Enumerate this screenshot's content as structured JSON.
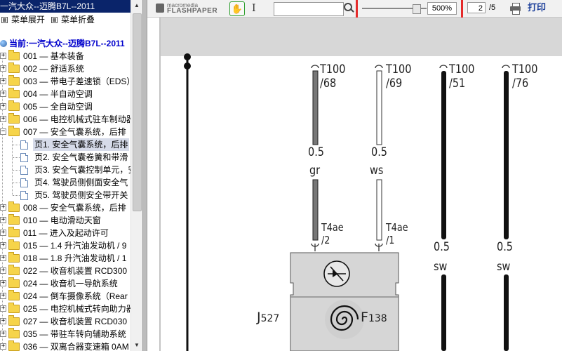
{
  "window": {
    "title": "一汽大众--迈腾B7L--2011"
  },
  "menu": {
    "expand_label": "菜单展开",
    "collapse_label": "菜单折叠"
  },
  "tree": {
    "current": "当前:一汽大众--迈腾B7L--2011",
    "items_a": [
      "001 — 基本装备",
      "002 — 舒适系统",
      "003 — 带电子差速锁（EDS）",
      "004 — 半自动空调",
      "005 — 全自动空调",
      "006 — 电控机械式驻车制动器",
      "007 — 安全气囊系统，后排"
    ],
    "pages": [
      "页1. 安全气囊系统，后排",
      "页2. 安全气囊卷簧和带滑",
      "页3. 安全气囊控制单元，安",
      "页4. 驾驶员侧侧面安全气",
      "页5. 驾驶员侧安全带开关"
    ],
    "items_b": [
      "008 — 安全气囊系统，后排",
      "010 — 电动滑动天窗",
      "011 — 进入及起动许可",
      "015 — 1.4 升汽油发动机 / 9",
      "018 — 1.8 升汽油发动机 / 1",
      "022 — 收音机装置 RCD300",
      "024 — 收音机一导航系统",
      "024 — 倒车摄像系统（Rear",
      "025 — 电控机械式转向助力器",
      "027 — 收音机装置 RCD030",
      "035 — 带驻车转向辅助系统",
      "036 — 双离合器变速箱 0AM"
    ]
  },
  "toolbar": {
    "logo_top": "macromedia",
    "logo_bottom": "FLASHPAPER",
    "search_value": "",
    "zoom_value": "500%",
    "zoom_level_fraction": 0.9,
    "page_current": "2",
    "page_total": "/5",
    "print_label": "打印",
    "highlight_color": "#e52a2a"
  },
  "diagram": {
    "wires": [
      {
        "pin_top": "T100",
        "pin_num": "/68",
        "gauge": "0.5",
        "color_code": "gr",
        "conn": "T4ae",
        "conn_pin": "/2"
      },
      {
        "pin_top": "T100",
        "pin_num": "/69",
        "gauge": "0.5",
        "color_code": "ws",
        "conn": "T4ae",
        "conn_pin": "/1"
      },
      {
        "pin_top": "T100",
        "pin_num": "/51",
        "gauge": "0.5",
        "color_code": "sw"
      },
      {
        "pin_top": "T100",
        "pin_num": "/76",
        "gauge": "0.5",
        "color_code": "sw"
      }
    ],
    "component_j": "J",
    "component_j_sub": "527",
    "component_f": "F",
    "component_f_sub": "138"
  }
}
